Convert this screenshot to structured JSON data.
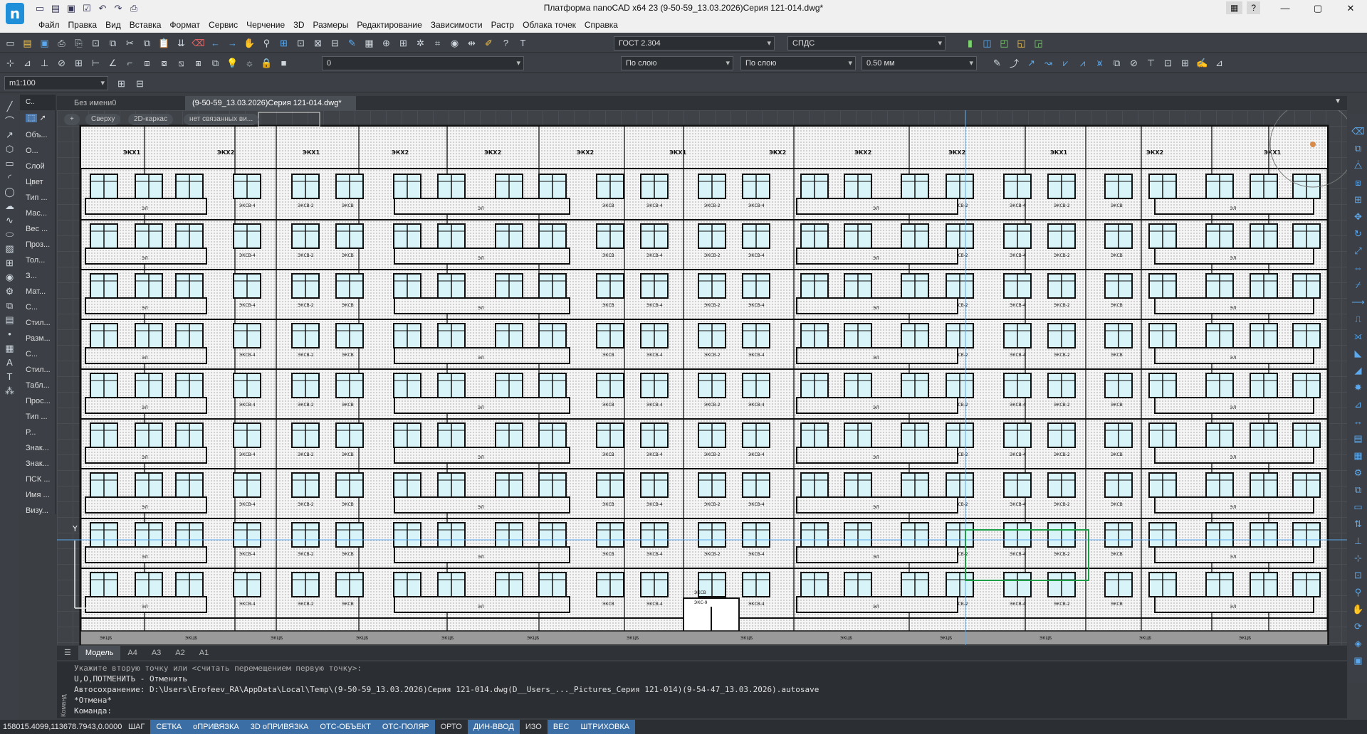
{
  "title_bar": {
    "app_logo": "nanoCAD-logo",
    "window_title": "Платформа nanoCAD x64 23 (9-50-59_13.03.2026)Серия 121-014.dwg*",
    "help_label": "?",
    "quick_access": [
      "new-icon",
      "open-icon",
      "save-icon",
      "saveall-icon",
      "undo-icon",
      "redo-icon",
      "print-icon"
    ],
    "controls": {
      "minimize": "—",
      "maximize": "▢",
      "close": "✕"
    }
  },
  "menu": [
    "Файл",
    "Правка",
    "Вид",
    "Вставка",
    "Формат",
    "Сервис",
    "Черчение",
    "3D",
    "Размеры",
    "Редактирование",
    "Зависимости",
    "Растр",
    "Облака точек",
    "Справка"
  ],
  "toolbar_row1": {
    "text_style": "ГОСТ 2.304",
    "dim_style": "СПДС"
  },
  "toolbar_row2": {
    "layer": "0",
    "color": "По слою",
    "linetype": "По слою",
    "lineweight": "0.50 мм"
  },
  "toolbar_row3": {
    "scale": "m1:100"
  },
  "left_panel": {
    "header": "С..",
    "items": [
      "Объ...",
      "О...",
      "Слой",
      "Цвет",
      "Тип ...",
      "Мас...",
      "Вес ...",
      "Проз...",
      "Тол...",
      "З...",
      "Мат...",
      "С...",
      "Стил...",
      "Разм...",
      "С...",
      "Стил...",
      "Табл...",
      "Прос...",
      "Тип ...",
      "Р...",
      "Знак...",
      "Знак...",
      "ПСК ...",
      "Имя ...",
      "Визу..."
    ]
  },
  "doc_tabs": [
    {
      "label": "Без имени0",
      "active": false
    },
    {
      "label": "(9-50-59_13.03.2026)Серия 121-014.dwg*",
      "active": true
    }
  ],
  "view_chips": [
    "Сверху",
    "2D-каркас",
    "нет связанных ви..."
  ],
  "drawing": {
    "floors": 9,
    "top_panels": [
      "ЭКХ1",
      "ЭКХ2",
      "ЭКХ1",
      "ЭКХ2",
      "ЭКХ2",
      "ЭКХ2",
      "ЭКХ1",
      "ЭКХ2",
      "ЭКХ2",
      "ЭКХ2",
      "ЭКХ1",
      "ЭКХ2",
      "ЭКХ1"
    ],
    "balcony_label": "ЭЛ",
    "window_labels": [
      "ЭКСВ",
      "ЭКСВ-4",
      "ЭКСВ-2",
      "ЭКСВ-4",
      "ЭКСВ-2"
    ],
    "entrance_labels": [
      "ЭКСВ",
      "ЭКС-9"
    ],
    "axis_label": "Y",
    "base_label": "ЭКЦБ"
  },
  "layout_tabs": [
    {
      "label": "Модель",
      "active": true
    },
    {
      "label": "A4",
      "active": false
    },
    {
      "label": "A3",
      "active": false
    },
    {
      "label": "A2",
      "active": false
    },
    {
      "label": "A1",
      "active": false
    }
  ],
  "command_line": {
    "label": "Команд",
    "lines": [
      "Укажите вторую точку или <считать перемещением первую точку>:",
      "U,O,ПОТМЕНИТЬ - Отменить",
      "Автосохранение: D:\\Users\\Erofeev_RA\\AppData\\Local\\Temp\\(9-50-59_13.03.2026)Серия 121-014.dwg(D__Users_..._Pictures_Серия 121-014)(9-54-47_13.03.2026).autosave",
      "*Отмена*",
      "Команда:"
    ]
  },
  "status_bar": {
    "coordinates": "158015.4099,113678.7943,0.0000",
    "toggles": [
      {
        "label": "ШАГ",
        "on": false
      },
      {
        "label": "СЕТКА",
        "on": true
      },
      {
        "label": "оПРИВЯЗКА",
        "on": true
      },
      {
        "label": "3D оПРИВЯЗКА",
        "on": true
      },
      {
        "label": "ОТС-ОБЪЕКТ",
        "on": true
      },
      {
        "label": "ОТС-ПОЛЯР",
        "on": true
      },
      {
        "label": "ОРТО",
        "on": false
      },
      {
        "label": "ДИН-ВВОД",
        "on": true
      },
      {
        "label": "ИЗО",
        "on": false
      },
      {
        "label": "ВЕС",
        "on": true
      },
      {
        "label": "ШТРИХОВКА",
        "on": true
      }
    ]
  },
  "colors": {
    "accent": "#3b6ea5",
    "canvas_bg": "#3f4348",
    "drawing_bg": "#ffffff",
    "window_glass": "#d8f4f8"
  }
}
